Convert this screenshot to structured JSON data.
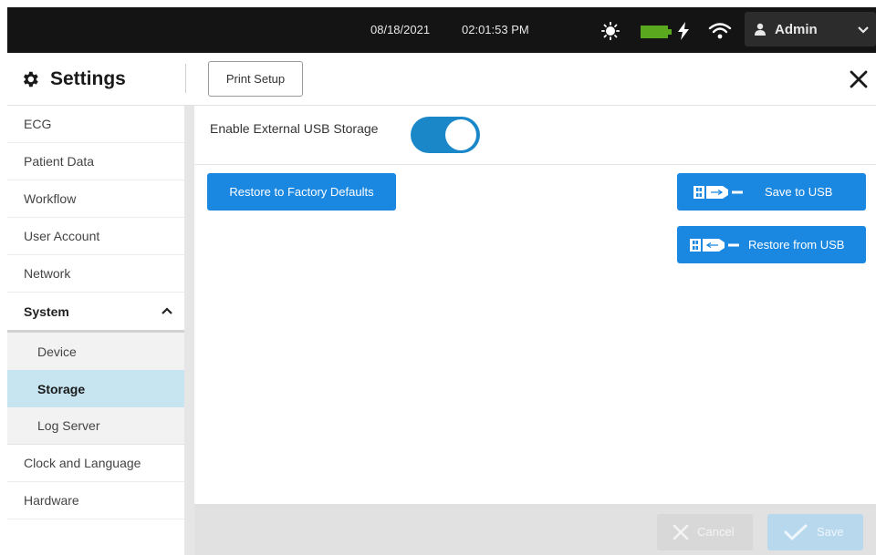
{
  "status_bar": {
    "date": "08/18/2021",
    "time": "02:01:53 PM",
    "icons": [
      "brightness-icon",
      "battery-icon",
      "charging-bolt-icon",
      "wifi-icon"
    ],
    "user": {
      "name": "Admin",
      "icon": "person-icon",
      "dropdown_icon": "chevron-down-icon"
    }
  },
  "header": {
    "title": "Settings",
    "icon": "gear-icon",
    "print_setup_label": "Print Setup",
    "close_icon": "close-icon"
  },
  "sidebar": {
    "items": [
      {
        "label": "ECG"
      },
      {
        "label": "Patient Data"
      },
      {
        "label": "Workflow"
      },
      {
        "label": "User Account"
      },
      {
        "label": "Network"
      },
      {
        "label": "System",
        "expanded": true
      },
      {
        "label": "Device"
      },
      {
        "label": "Storage",
        "active": true
      },
      {
        "label": "Log Server"
      },
      {
        "label": "Clock and Language"
      },
      {
        "label": "Hardware"
      }
    ]
  },
  "main": {
    "usb_storage_label": "Enable External USB Storage",
    "usb_storage_enabled": true,
    "restore_defaults_label": "Restore to Factory Defaults",
    "save_usb_label": "Save to USB",
    "restore_usb_label": "Restore from USB"
  },
  "footer": {
    "cancel_label": "Cancel",
    "save_label": "Save"
  },
  "colors": {
    "accent_blue": "#1a87e1",
    "toggle_on": "#1a87c9",
    "active_nav": "#c6e5f1",
    "battery_green": "#5aa81e",
    "top_bar": "#141414"
  }
}
